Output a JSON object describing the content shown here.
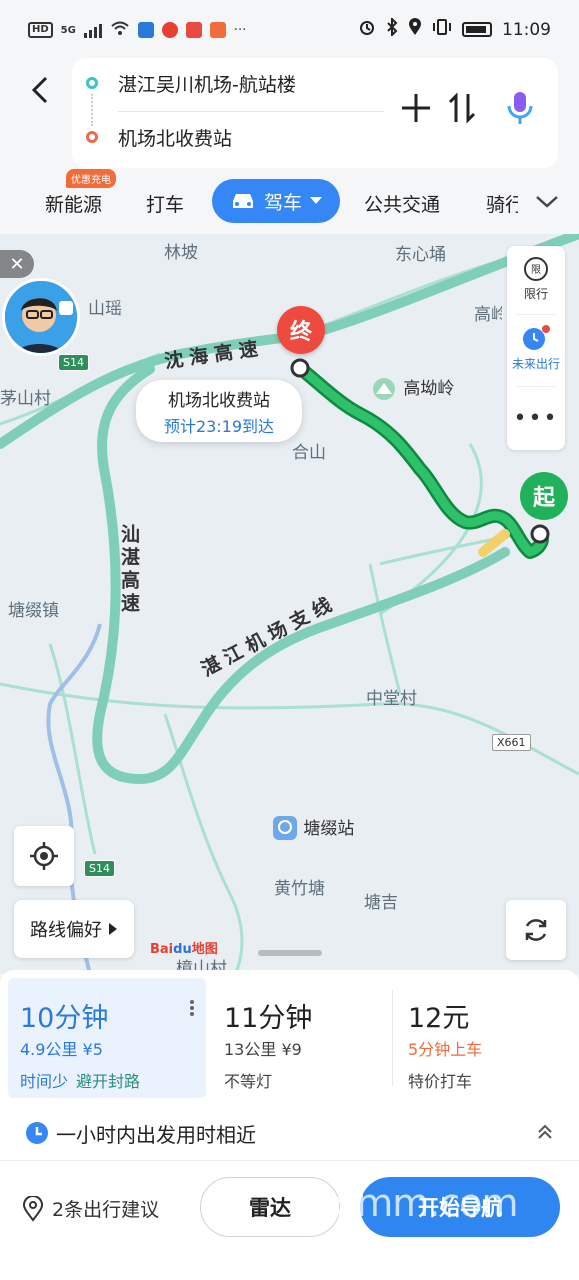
{
  "status_bar": {
    "network": "HD",
    "signal": "5G",
    "time": "11:09"
  },
  "header": {
    "from": "湛江吴川机场-航站楼",
    "to": "机场北收费站"
  },
  "tabs": {
    "items": [
      "新能源",
      "打车",
      "驾车",
      "公共交通",
      "骑行"
    ],
    "active": "驾车",
    "badge": "优惠充电"
  },
  "map": {
    "labels": {
      "linpo": "林坡",
      "dongxin": "东心埇",
      "shanyao": "山瑶",
      "maoshan": "茅山村",
      "gaoao": "高坳岭",
      "hexian": "合山",
      "gaoxian": "高岭",
      "tangzhui_town": "塘缀镇",
      "zhongtang": "中堂村",
      "tangzhui_station": "塘缀站",
      "huangzhu": "黄竹塘",
      "tangji": "塘吉",
      "zhangshan": "樟山村"
    },
    "road_names": {
      "shenhai": "沈海高速",
      "shanzhan": "汕湛高速",
      "zhanjiang_branch": "湛江机场支线"
    },
    "shields": [
      "S14",
      "S14"
    ],
    "plate": "X661",
    "end_marker": "终",
    "start_marker": "起",
    "destination_card": {
      "name": "机场北收费站",
      "eta": "预计23:19到达"
    },
    "side_panel": {
      "restrict": "限行",
      "future": "未来出行"
    },
    "preference": "路线偏好",
    "logo_text": "Bai",
    "logo_mid": "du",
    "logo_tail": "地图"
  },
  "routes": [
    {
      "time": "10分钟",
      "detail": "4.9公里 ¥5",
      "tag": "时间少",
      "tag2": "避开封路"
    },
    {
      "time": "11分钟",
      "detail": "13公里 ¥9",
      "tag": "不等灯"
    },
    {
      "time": "12元",
      "detail": "5分钟上车",
      "tag": "特价打车"
    }
  ],
  "notice": "一小时内出发用时相近",
  "bottom": {
    "suggestion": "2条出行建议",
    "radar": "雷达",
    "navigate": "开始导航",
    "watermark": "gdmm.com"
  },
  "colors": {
    "primary": "#3487f4",
    "route_green": "#1fa55a",
    "end_red": "#ef4a3f",
    "accent_orange": "#f26b3a"
  }
}
